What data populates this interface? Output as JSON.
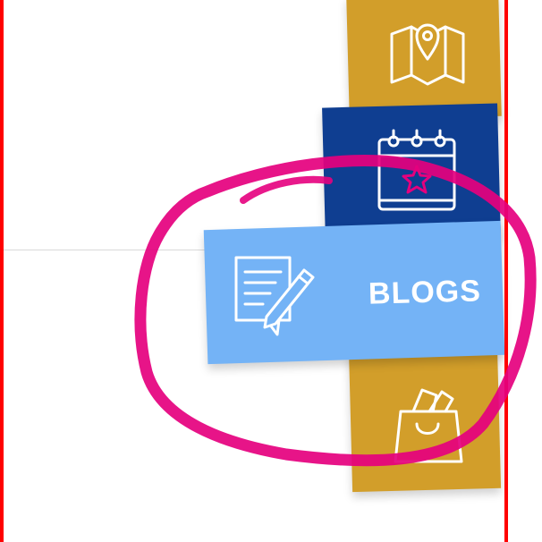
{
  "menu": {
    "items": [
      {
        "label": "",
        "icon": "map-pin-icon"
      },
      {
        "label": "",
        "icon": "calendar-star-icon"
      },
      {
        "label": "BLOGS",
        "icon": "blog-edit-icon"
      },
      {
        "label": "",
        "icon": "shopping-bag-icon"
      }
    ]
  },
  "colors": {
    "gold": "#d29e2a",
    "navy": "#0f3e91",
    "light_blue": "#74b3f6",
    "annotation_pink": "#e5007e",
    "border_red": "#ff0000"
  }
}
